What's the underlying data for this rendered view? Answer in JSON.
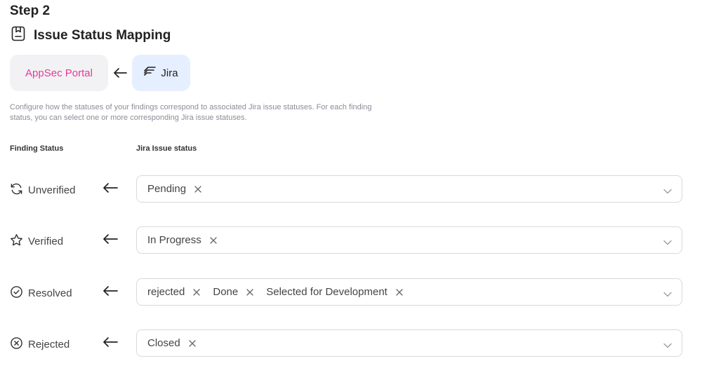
{
  "header": {
    "step": "Step 2",
    "title": "Issue Status Mapping",
    "title_icon": "clipboard-icon"
  },
  "integration": {
    "source": "AppSec Portal",
    "target": "Jira",
    "source_color": "#e6399b",
    "target_bg": "#e6efff"
  },
  "description": "Configure how the statuses of your findings correspond to associated Jira issue statuses. For each finding status, you can select one or more corresponding Jira issue statuses.",
  "columns": {
    "finding": "Finding Status",
    "jira": "Jira Issue status"
  },
  "mappings": [
    {
      "status": "Unverified",
      "icon": "refresh-icon",
      "tags": [
        "Pending"
      ]
    },
    {
      "status": "Verified",
      "icon": "star-icon",
      "tags": [
        "In Progress"
      ]
    },
    {
      "status": "Resolved",
      "icon": "check-circle-icon",
      "tags": [
        "rejected",
        "Done",
        "Selected for Development"
      ]
    },
    {
      "status": "Rejected",
      "icon": "x-circle-icon",
      "tags": [
        "Closed"
      ]
    }
  ]
}
